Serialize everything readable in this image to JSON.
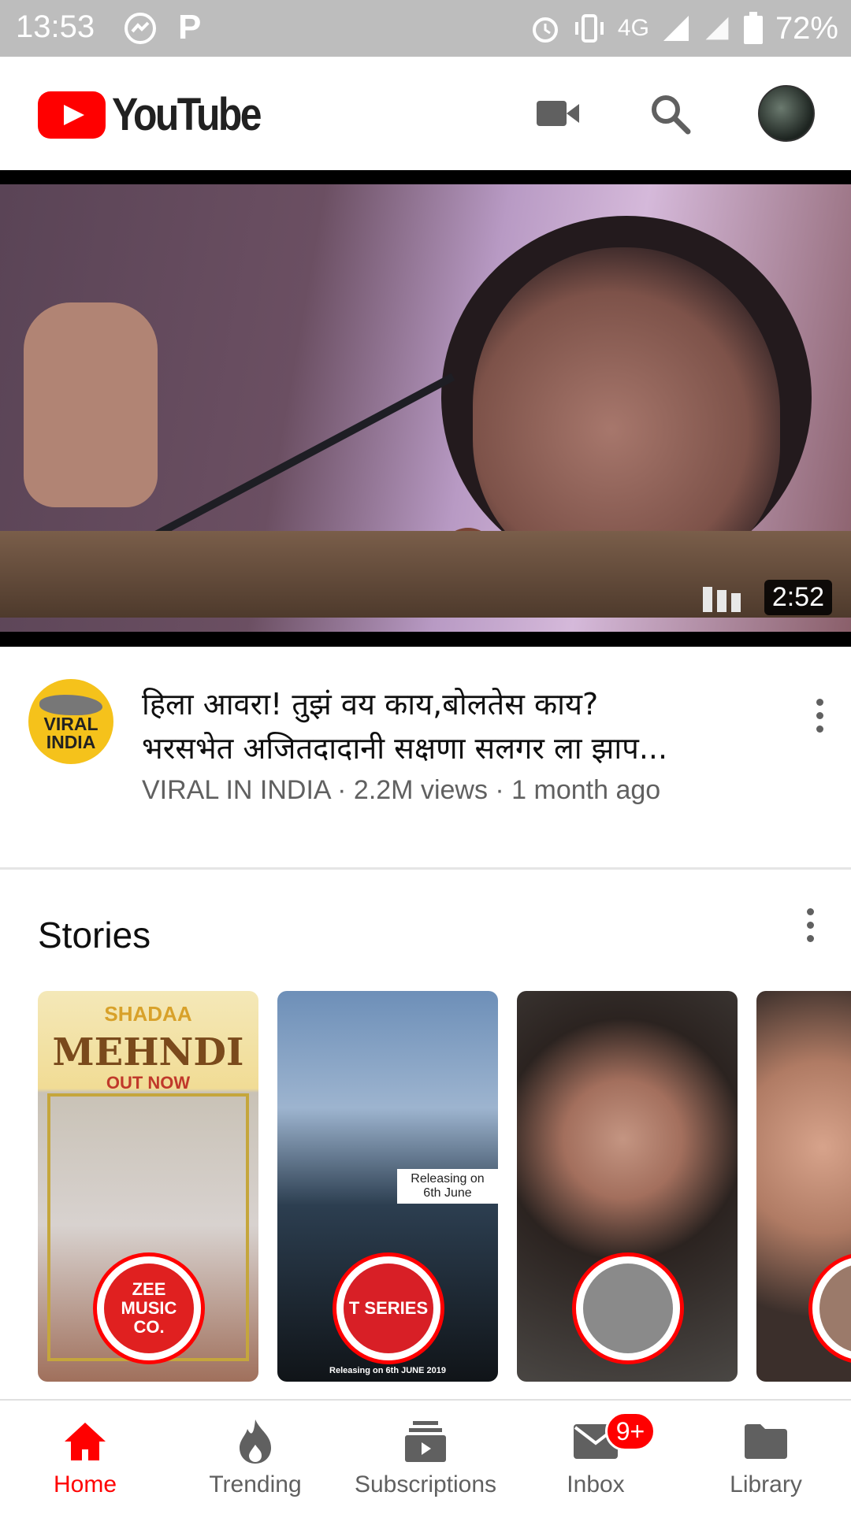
{
  "status_bar": {
    "time": "13:53",
    "network": "4G",
    "battery": "72%"
  },
  "app_bar": {
    "logo_text": "YouTube",
    "camera_icon": "video-camera-icon",
    "search_icon": "search-icon",
    "account_icon": "avatar"
  },
  "video": {
    "duration": "2:52",
    "title_line1": "हिला आवरा! तुझं वय काय,बोलतेस काय?",
    "title_line2": "भरसभेत अजितदादानी सक्षणा सलगर ला झाप...",
    "channel_avatar_text": "VIRAL INDIA",
    "meta": "VIRAL IN INDIA · 2.2M views · 1 month ago"
  },
  "stories": {
    "title": "Stories",
    "items": [
      {
        "heading_small": "SHADAA",
        "heading_big": "MEHNDI",
        "heading_tag": "OUT NOW",
        "avatar_text": "ZEE MUSIC CO."
      },
      {
        "badge_text": "Releasing on 6th June",
        "footer_text": "Releasing on 6th JUNE 2019",
        "avatar_text": "T SERIES"
      },
      {
        "avatar_text": ""
      },
      {
        "avatar_text": ""
      }
    ]
  },
  "bottom_nav": {
    "items": [
      {
        "label": "Home",
        "icon": "home-icon"
      },
      {
        "label": "Trending",
        "icon": "flame-icon"
      },
      {
        "label": "Subscriptions",
        "icon": "subscriptions-icon"
      },
      {
        "label": "Inbox",
        "icon": "mail-icon"
      },
      {
        "label": "Library",
        "icon": "folder-icon"
      }
    ],
    "inbox_badge": "9+"
  },
  "colors": {
    "brand_red": "#ff0000",
    "text_secondary": "#606060",
    "status_bar_bg": "#bdbdbd"
  }
}
